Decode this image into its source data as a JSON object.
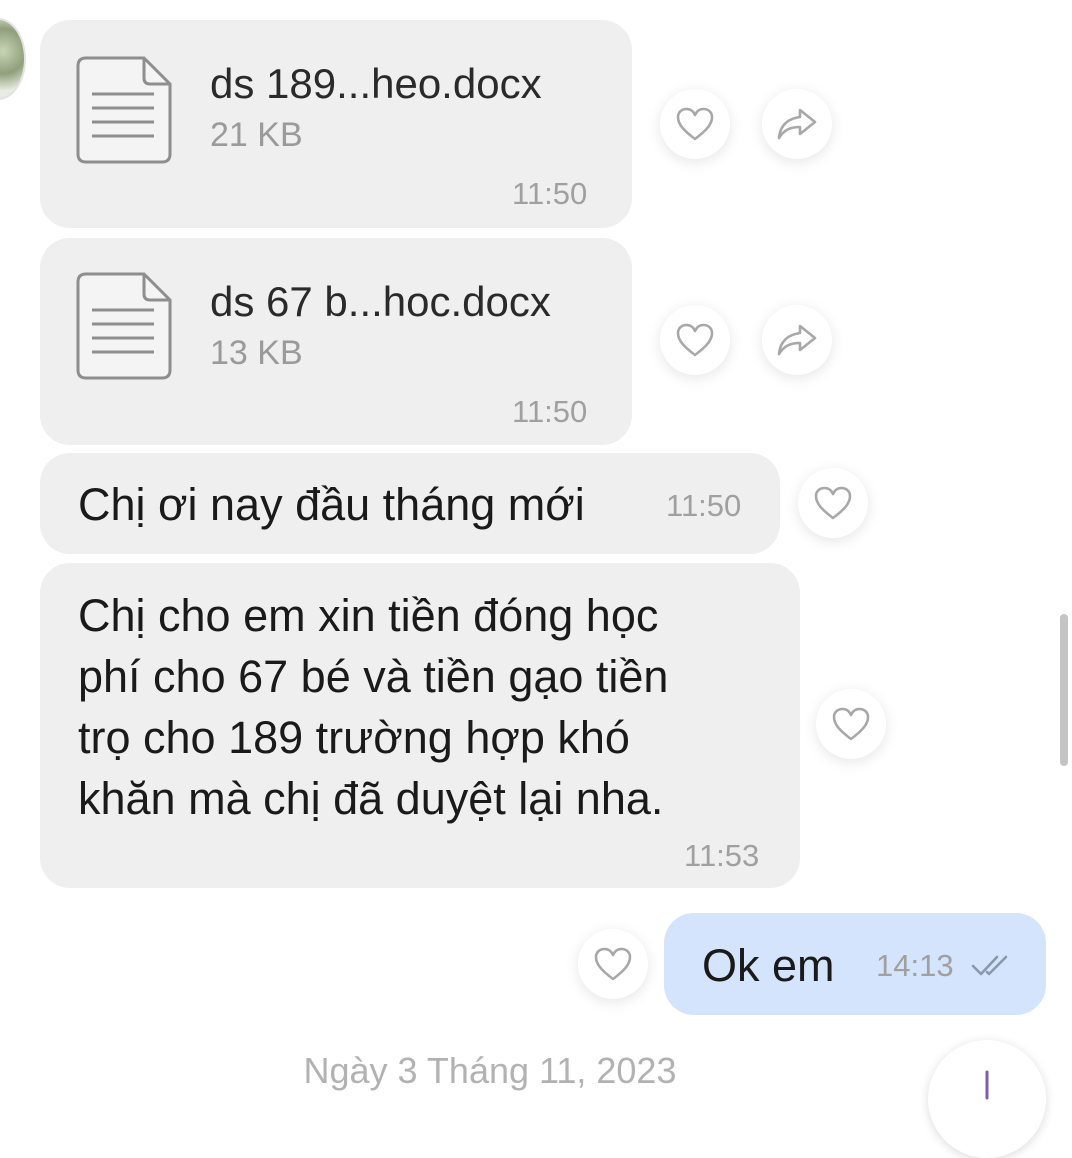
{
  "messages": [
    {
      "type": "file",
      "name": "ds 189...heo.docx",
      "size": "21 KB",
      "time": "11:50"
    },
    {
      "type": "file",
      "name": "ds 67 b...hoc.docx",
      "size": "13 KB",
      "time": "11:50"
    },
    {
      "type": "text",
      "lines": [
        "Chị ơi nay đầu tháng mới"
      ],
      "time": "11:50"
    },
    {
      "type": "text",
      "lines": [
        "Chị cho em xin tiền đóng học",
        "phí cho 67 bé và tiền gạo tiền",
        "trọ cho 189 trường hợp khó",
        "khăn mà chị đã duyệt lại nha."
      ],
      "time": "11:53"
    },
    {
      "type": "outgoing",
      "lines": [
        "Ok em"
      ],
      "time": "14:13",
      "status_icon": "double-check-icon"
    }
  ],
  "date_separator": "Ngày 3 Tháng 11, 2023",
  "icons": {
    "react": "heart-outline-icon",
    "forward": "share-arrow-icon",
    "file": "document-icon",
    "scroll_down": "chevron-down-icon"
  },
  "colors": {
    "incoming_bubble": "#efefef",
    "outgoing_bubble": "#d3e4fc",
    "timestamp": "#a0a0a0",
    "accent": "#7a5fb0"
  }
}
